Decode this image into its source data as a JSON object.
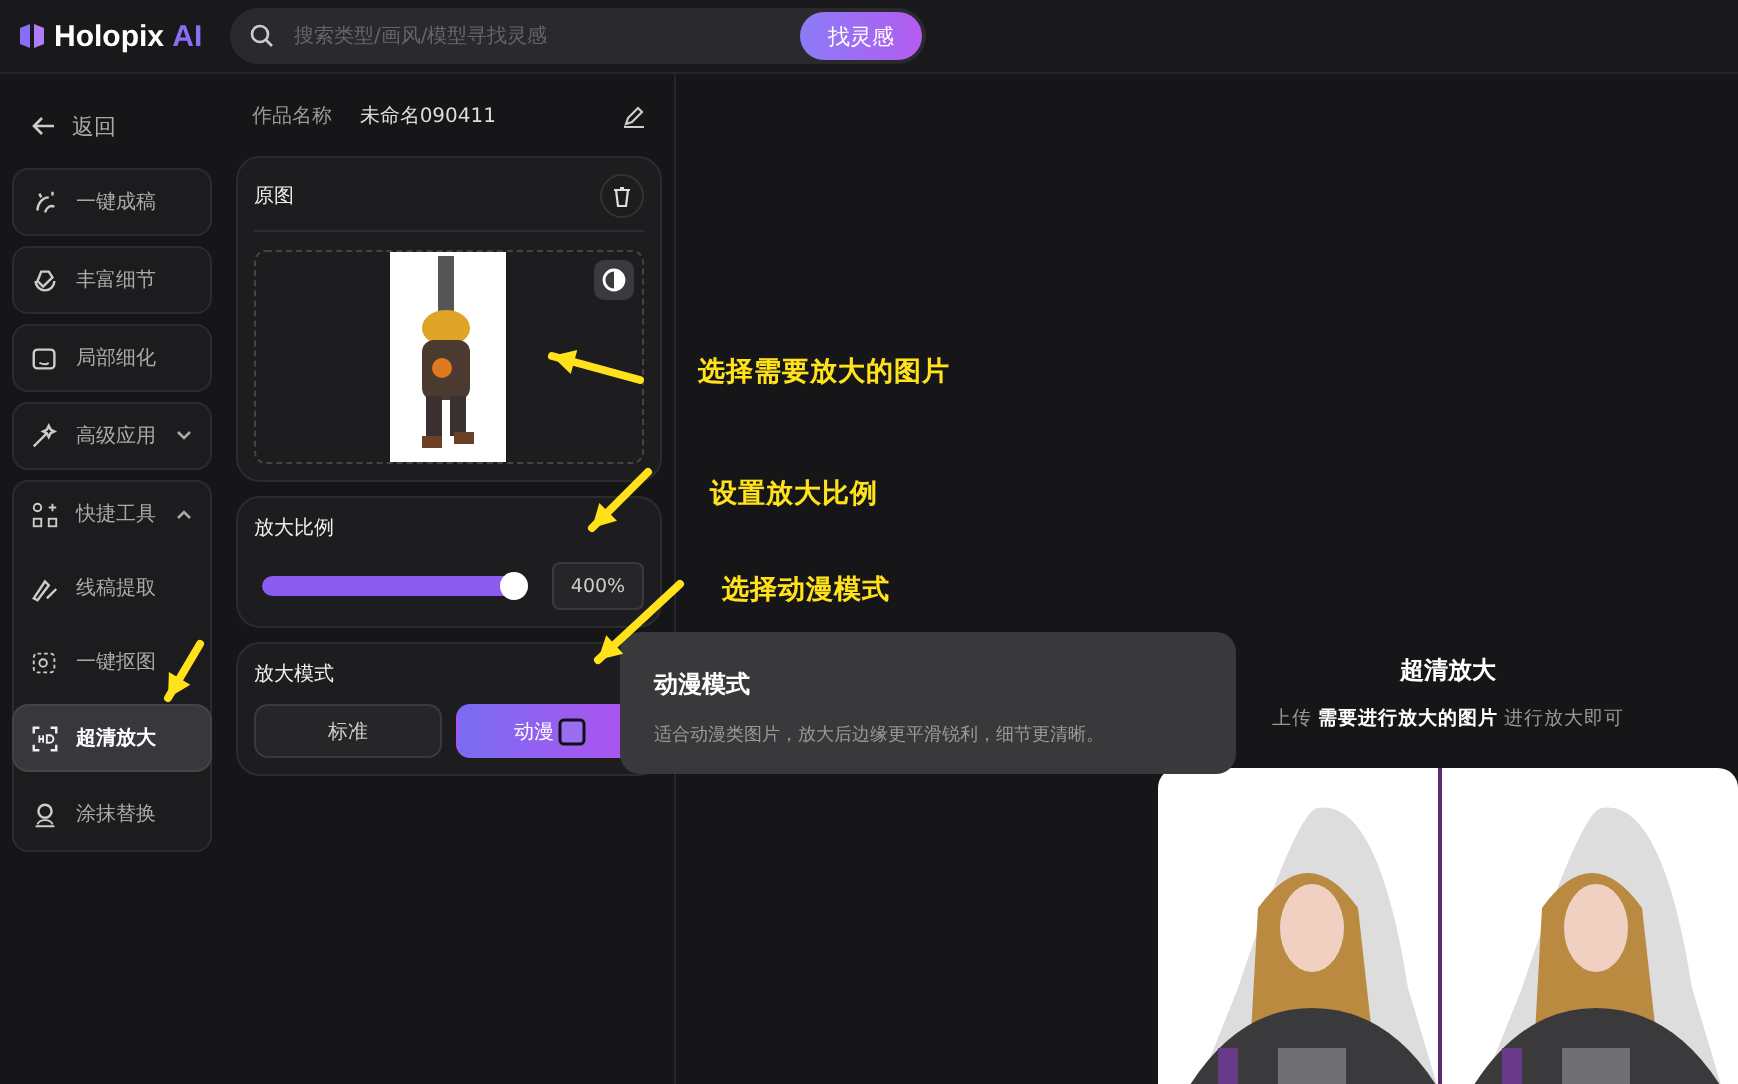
{
  "header": {
    "logo_text": "Holopix",
    "logo_accent": "AI",
    "search": {
      "placeholder": "搜索类型/画风/模型寻找灵感"
    },
    "search_button": "找灵感"
  },
  "sidebar": {
    "back": "返回",
    "items": [
      {
        "kind": "item",
        "label": "一键成稿",
        "selected": false
      },
      {
        "kind": "item",
        "label": "丰富细节",
        "selected": false
      },
      {
        "kind": "item",
        "label": "局部细化",
        "selected": false
      },
      {
        "kind": "group",
        "label": "高级应用",
        "expanded": false
      },
      {
        "kind": "group",
        "label": "快捷工具",
        "expanded": true,
        "children": [
          {
            "label": "线稿提取",
            "selected": false
          },
          {
            "label": "一键抠图",
            "selected": false
          },
          {
            "label": "超清放大",
            "selected": true
          },
          {
            "label": "涂抹替换",
            "selected": false
          }
        ]
      }
    ]
  },
  "panel": {
    "name_label": "作品名称",
    "name_value": "未命名090411",
    "source": {
      "title": "原图"
    },
    "scale": {
      "title": "放大比例",
      "level": 1,
      "value": "400%"
    },
    "mode": {
      "title": "放大模式",
      "options": [
        {
          "label": "标准",
          "selected": false
        },
        {
          "label": "动漫",
          "selected": true
        }
      ]
    }
  },
  "tooltip": {
    "title": "动漫模式",
    "text": "适合动漫类图片，放大后边缘更平滑锐利，细节更清晰。"
  },
  "main": {
    "title": "超清放大",
    "subtitle": "上传 **需要进行放大的图片** 进行放大即可"
  },
  "annotations": [
    "选择需要放大的图片",
    "设置放大比例",
    "选择动漫模式"
  ]
}
